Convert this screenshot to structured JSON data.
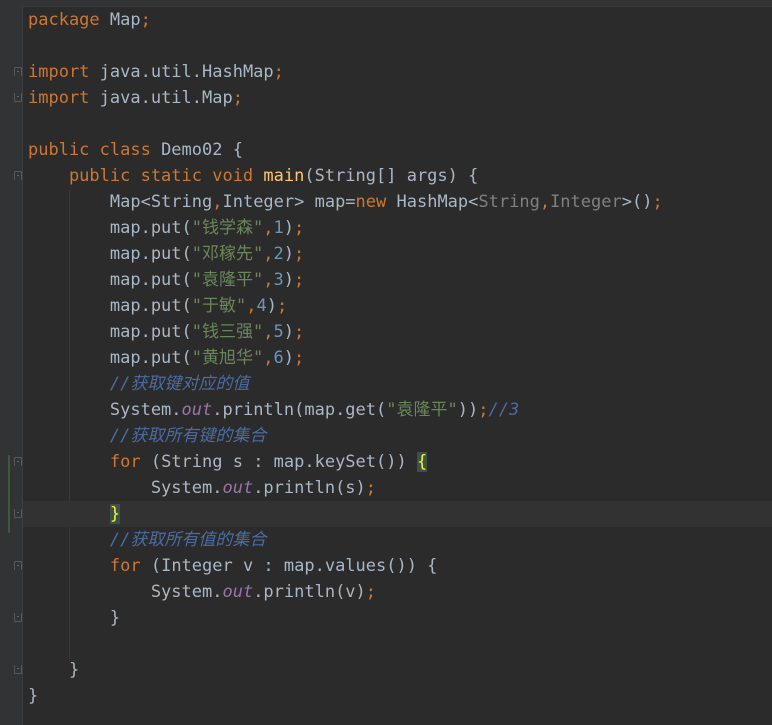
{
  "code_lines": [
    {
      "tokens": [
        {
          "t": "package ",
          "c": "kw"
        },
        {
          "t": "Map",
          "c": ""
        },
        {
          "t": ";",
          "c": "kw"
        }
      ]
    },
    {
      "tokens": []
    },
    {
      "tokens": [
        {
          "t": "import ",
          "c": "kw"
        },
        {
          "t": "java.util.HashMap",
          "c": ""
        },
        {
          "t": ";",
          "c": "kw"
        }
      ]
    },
    {
      "tokens": [
        {
          "t": "import ",
          "c": "kw"
        },
        {
          "t": "java.util.Map",
          "c": ""
        },
        {
          "t": ";",
          "c": "kw"
        }
      ]
    },
    {
      "tokens": []
    },
    {
      "tokens": [
        {
          "t": "public class ",
          "c": "kw"
        },
        {
          "t": "Demo02 {",
          "c": ""
        }
      ]
    },
    {
      "tokens": [
        {
          "t": "    public static void ",
          "c": "kw"
        },
        {
          "t": "main",
          "c": "fn"
        },
        {
          "t": "(String[] args) {",
          "c": ""
        }
      ]
    },
    {
      "tokens": [
        {
          "t": "        Map<String",
          "c": ""
        },
        {
          "t": ",",
          "c": "kw"
        },
        {
          "t": "Integer> map=",
          "c": ""
        },
        {
          "t": "new ",
          "c": "kw"
        },
        {
          "t": "HashMap<",
          "c": ""
        },
        {
          "t": "String",
          "c": "gen"
        },
        {
          "t": ",",
          "c": "kw"
        },
        {
          "t": "Integer",
          "c": "gen"
        },
        {
          "t": ">()",
          "c": ""
        },
        {
          "t": ";",
          "c": "kw"
        }
      ]
    },
    {
      "tokens": [
        {
          "t": "        map.put(",
          "c": ""
        },
        {
          "t": "\"钱学森\"",
          "c": "str"
        },
        {
          "t": ",",
          "c": "kw"
        },
        {
          "t": "1",
          "c": "num"
        },
        {
          "t": ")",
          "c": ""
        },
        {
          "t": ";",
          "c": "kw"
        }
      ]
    },
    {
      "tokens": [
        {
          "t": "        map.put(",
          "c": ""
        },
        {
          "t": "\"邓稼先\"",
          "c": "str"
        },
        {
          "t": ",",
          "c": "kw"
        },
        {
          "t": "2",
          "c": "num"
        },
        {
          "t": ")",
          "c": ""
        },
        {
          "t": ";",
          "c": "kw"
        }
      ]
    },
    {
      "tokens": [
        {
          "t": "        map.put(",
          "c": ""
        },
        {
          "t": "\"袁隆平\"",
          "c": "str"
        },
        {
          "t": ",",
          "c": "kw"
        },
        {
          "t": "3",
          "c": "num"
        },
        {
          "t": ")",
          "c": ""
        },
        {
          "t": ";",
          "c": "kw"
        }
      ]
    },
    {
      "tokens": [
        {
          "t": "        map.put(",
          "c": ""
        },
        {
          "t": "\"于敏\"",
          "c": "str"
        },
        {
          "t": ",",
          "c": "kw"
        },
        {
          "t": "4",
          "c": "num"
        },
        {
          "t": ")",
          "c": ""
        },
        {
          "t": ";",
          "c": "kw"
        }
      ]
    },
    {
      "tokens": [
        {
          "t": "        map.put(",
          "c": ""
        },
        {
          "t": "\"钱三强\"",
          "c": "str"
        },
        {
          "t": ",",
          "c": "kw"
        },
        {
          "t": "5",
          "c": "num"
        },
        {
          "t": ")",
          "c": ""
        },
        {
          "t": ";",
          "c": "kw"
        }
      ]
    },
    {
      "tokens": [
        {
          "t": "        map.put(",
          "c": ""
        },
        {
          "t": "\"黄旭华\"",
          "c": "str"
        },
        {
          "t": ",",
          "c": "kw"
        },
        {
          "t": "6",
          "c": "num"
        },
        {
          "t": ")",
          "c": ""
        },
        {
          "t": ";",
          "c": "kw"
        }
      ]
    },
    {
      "tokens": [
        {
          "t": "        ",
          "c": ""
        },
        {
          "t": "//获取键对应的值",
          "c": "cmt-blue"
        }
      ]
    },
    {
      "tokens": [
        {
          "t": "        System.",
          "c": ""
        },
        {
          "t": "out",
          "c": "field"
        },
        {
          "t": ".println(map.get(",
          "c": ""
        },
        {
          "t": "\"袁隆平\"",
          "c": "str"
        },
        {
          "t": "))",
          "c": ""
        },
        {
          "t": ";",
          "c": "kw"
        },
        {
          "t": "//3",
          "c": "cmt-blue"
        }
      ]
    },
    {
      "tokens": [
        {
          "t": "        ",
          "c": ""
        },
        {
          "t": "//获取所有键的集合",
          "c": "cmt-blue"
        }
      ]
    },
    {
      "tokens": [
        {
          "t": "        ",
          "c": ""
        },
        {
          "t": "for ",
          "c": "kw"
        },
        {
          "t": "(String s : map.keySet()) ",
          "c": ""
        },
        {
          "t": "{",
          "c": "brace-hl"
        }
      ]
    },
    {
      "tokens": [
        {
          "t": "            System.",
          "c": ""
        },
        {
          "t": "out",
          "c": "field"
        },
        {
          "t": ".println(s)",
          "c": ""
        },
        {
          "t": ";",
          "c": "kw"
        }
      ]
    },
    {
      "tokens": [
        {
          "t": "        ",
          "c": ""
        },
        {
          "t": "}",
          "c": "brace-hl"
        }
      ],
      "current": true
    },
    {
      "tokens": [
        {
          "t": "        ",
          "c": ""
        },
        {
          "t": "//获取所有值的集合",
          "c": "cmt-blue"
        }
      ]
    },
    {
      "tokens": [
        {
          "t": "        ",
          "c": ""
        },
        {
          "t": "for ",
          "c": "kw"
        },
        {
          "t": "(Integer v : map.values()) {",
          "c": ""
        }
      ]
    },
    {
      "tokens": [
        {
          "t": "            System.",
          "c": ""
        },
        {
          "t": "out",
          "c": "field"
        },
        {
          "t": ".println(v)",
          "c": ""
        },
        {
          "t": ";",
          "c": "kw"
        }
      ]
    },
    {
      "tokens": [
        {
          "t": "        }",
          "c": ""
        }
      ]
    },
    {
      "tokens": []
    },
    {
      "tokens": [
        {
          "t": "    }",
          "c": ""
        }
      ]
    },
    {
      "tokens": [
        {
          "t": "}",
          "c": ""
        }
      ]
    }
  ],
  "fold_markers": [
    {
      "line": 2,
      "kind": "open"
    },
    {
      "line": 3,
      "kind": "close"
    },
    {
      "line": 6,
      "kind": "open"
    },
    {
      "line": 17,
      "kind": "open"
    },
    {
      "line": 19,
      "kind": "close"
    },
    {
      "line": 21,
      "kind": "open"
    },
    {
      "line": 23,
      "kind": "close"
    },
    {
      "line": 25,
      "kind": "close"
    }
  ],
  "colors": {
    "background": "#2b2b2b",
    "keyword": "#cc7832",
    "method": "#ffc66d",
    "string": "#6a8759",
    "number": "#6897bb",
    "field": "#9876aa",
    "comment": "#4a6ca3"
  },
  "icons": [
    "fold-marker-icon",
    "intention-bulb-icon"
  ]
}
